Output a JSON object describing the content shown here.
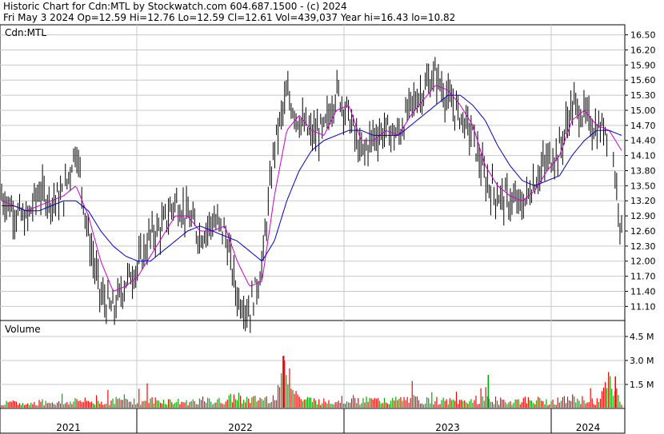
{
  "header": {
    "line1": "Historic Chart for Cdn:MTL by Stockwatch.com 604.687.1500 - (c) 2024",
    "line2": "Fri May  3 2024  Op=12.59  Hi=12.76  Lo=12.59  Cl=12.61  Vol=439,037  Year hi=16.43  lo=10.82"
  },
  "colors": {
    "background": "#ffffff",
    "grid": "#c8c8c8",
    "price": "#000000",
    "ma_short": "#cc00cc",
    "ma_long": "#0000cc",
    "volume_down": "#ff0000",
    "volume_up": "#00aa00"
  },
  "chart_data": [
    {
      "type": "line",
      "title": "Cdn:MTL",
      "xlabel": "",
      "ylabel": "",
      "ylim": [
        10.82,
        16.7
      ],
      "yticks": [
        "16.50",
        "16.20",
        "15.90",
        "15.60",
        "15.30",
        "15.00",
        "14.70",
        "14.40",
        "14.10",
        "13.80",
        "13.50",
        "13.20",
        "12.90",
        "12.60",
        "12.30",
        "12.00",
        "11.70",
        "11.40",
        "11.10"
      ],
      "x_years": [
        "2021",
        "2022",
        "2023",
        "2024"
      ],
      "grid": true,
      "x": [
        "2021-01",
        "2021-02",
        "2021-03",
        "2021-04",
        "2021-05",
        "2021-06",
        "2021-07",
        "2021-08",
        "2021-09",
        "2021-10",
        "2021-11",
        "2021-12",
        "2022-01",
        "2022-02",
        "2022-03",
        "2022-04",
        "2022-05",
        "2022-06",
        "2022-07",
        "2022-08",
        "2022-09",
        "2022-10",
        "2022-11",
        "2022-12",
        "2023-01",
        "2023-02",
        "2023-03",
        "2023-04",
        "2023-05",
        "2023-06",
        "2023-07",
        "2023-08",
        "2023-09",
        "2023-10",
        "2023-11",
        "2023-12",
        "2024-01",
        "2024-02",
        "2024-03",
        "2024-04",
        "2024-05"
      ],
      "series": [
        {
          "values": [
            13.3,
            13.0,
            12.8,
            13.4,
            13.2,
            13.3,
            14.3,
            12.5,
            11.3,
            11.0,
            11.6,
            11.9,
            12.5,
            12.7,
            13.2,
            12.9,
            12.5,
            12.8,
            12.6,
            11.3,
            11.0,
            11.9,
            14.3,
            15.3,
            14.8,
            14.5,
            14.6,
            15.4,
            14.9,
            14.1,
            14.5,
            14.6,
            14.5,
            15.1,
            15.4,
            15.7,
            15.2,
            14.9,
            14.5,
            13.6,
            13.3,
            13.2,
            13.1,
            13.6,
            14.0,
            14.2,
            15.1,
            14.9,
            14.6,
            14.7,
            12.6
          ]
        },
        {
          "values": [
            13.2,
            13.1,
            13.0,
            13.1,
            13.2,
            13.3,
            13.5,
            12.9,
            12.0,
            11.4,
            11.5,
            11.7,
            12.1,
            12.5,
            12.9,
            12.9,
            12.6,
            12.6,
            12.7,
            12.0,
            11.5,
            11.6,
            13.3,
            14.6,
            14.9,
            14.6,
            14.5,
            15.0,
            15.1,
            14.4,
            14.4,
            14.6,
            14.5,
            14.9,
            15.2,
            15.5,
            15.4,
            15.1,
            14.7,
            13.9,
            13.5,
            13.3,
            13.2,
            13.4,
            13.8,
            14.1,
            14.8,
            15.0,
            14.7,
            14.6,
            14.2
          ]
        },
        {
          "values": [
            13.1,
            13.1,
            13.0,
            13.0,
            13.1,
            13.2,
            13.2,
            13.0,
            12.6,
            12.3,
            12.1,
            12.0,
            12.0,
            12.2,
            12.4,
            12.6,
            12.7,
            12.6,
            12.5,
            12.4,
            12.2,
            12.0,
            12.4,
            13.2,
            13.8,
            14.2,
            14.4,
            14.5,
            14.6,
            14.6,
            14.5,
            14.5,
            14.5,
            14.7,
            14.9,
            15.1,
            15.3,
            15.3,
            15.1,
            14.8,
            14.3,
            13.9,
            13.6,
            13.5,
            13.6,
            13.7,
            14.1,
            14.4,
            14.6,
            14.6,
            14.5
          ]
        }
      ]
    },
    {
      "type": "bar",
      "title": "Volume",
      "xlabel": "",
      "ylabel": "",
      "ylim": [
        0,
        5.5
      ],
      "yticks": [
        "4.5 M",
        "3.0 M",
        "1.5 M"
      ],
      "x_years": [
        "2021",
        "2022",
        "2023",
        "2024"
      ],
      "grid": true,
      "values": [
        0.35,
        0.4,
        0.3,
        0.45,
        0.5,
        0.35,
        0.6,
        0.5,
        0.45,
        0.55,
        0.7,
        0.5,
        0.6,
        0.55,
        0.5,
        0.45,
        0.6,
        0.5,
        0.55,
        0.9,
        0.6,
        0.7,
        0.8,
        3.3,
        0.7,
        0.6,
        0.5,
        0.6,
        0.7,
        0.55,
        0.6,
        0.5,
        0.6,
        0.7,
        0.55,
        0.6,
        0.5,
        0.5,
        0.6,
        0.7,
        0.55,
        0.5,
        0.6,
        0.6,
        0.5,
        0.55,
        0.7,
        0.6,
        0.5,
        1.9,
        0.5
      ]
    }
  ]
}
